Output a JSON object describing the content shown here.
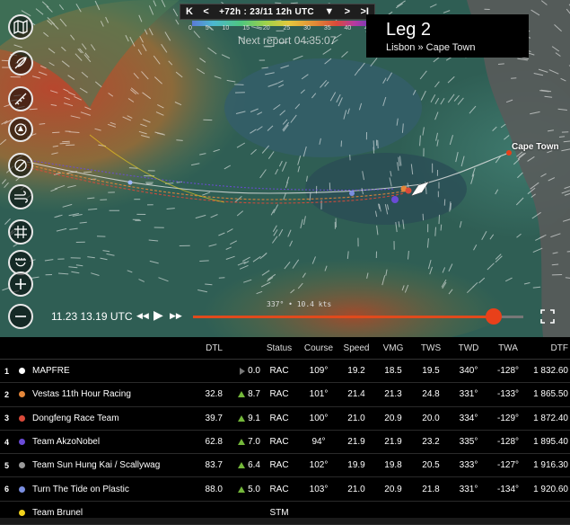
{
  "header": {
    "nav_first": "K",
    "nav_prev": "<",
    "time_label": "+72h : 23/11 12h UTC",
    "time_dropdown": "▼",
    "nav_next": ">",
    "nav_last": ">I",
    "legend_ticks": [
      "0",
      "5",
      "10",
      "15",
      "20",
      "25",
      "30",
      "35",
      "40",
      "45"
    ],
    "next_report": "Next report 04:35:07"
  },
  "leg": {
    "title": "Leg 2",
    "route": "Lisbon » Cape Town"
  },
  "map": {
    "destination_label": "Cape Town",
    "heading_readout": "337° • 10.4 kts",
    "tools": [
      "map-icon",
      "feather-icon",
      "ruler-icon",
      "boat-icon",
      "compass-icon",
      "wind-icon",
      "grid-icon",
      "sail-icon",
      "zoom-in-icon",
      "zoom-out-icon"
    ]
  },
  "playback": {
    "time": "11.23 13.19 UTC",
    "rewind": "◀◀",
    "play": "▶",
    "forward": "▶▶",
    "progress": 0.91
  },
  "table": {
    "headers": {
      "dtl": "DTL",
      "status": "Status",
      "course": "Course",
      "speed": "Speed",
      "vmg": "VMG",
      "tws": "TWS",
      "twd": "TWD",
      "twa": "TWA",
      "dtf": "DTF"
    },
    "rows": [
      {
        "rank": "1",
        "color": "#ffffff",
        "name": "MAPFRE",
        "dtl": "",
        "delta": "0.0",
        "delta_dir": "flat",
        "status": "RAC",
        "course": "109°",
        "speed": "19.2",
        "vmg": "18.5",
        "tws": "19.5",
        "twd": "340°",
        "twa": "-128°",
        "dtf": "1 832.60"
      },
      {
        "rank": "2",
        "color": "#e5873a",
        "name": "Vestas 11th Hour Racing",
        "dtl": "32.8",
        "delta": "8.7",
        "delta_dir": "up",
        "status": "RAC",
        "course": "101°",
        "speed": "21.4",
        "vmg": "21.3",
        "tws": "24.8",
        "twd": "331°",
        "twa": "-133°",
        "dtf": "1 865.50"
      },
      {
        "rank": "3",
        "color": "#d94a3a",
        "name": "Dongfeng Race Team",
        "dtl": "39.7",
        "delta": "9.1",
        "delta_dir": "up",
        "status": "RAC",
        "course": "100°",
        "speed": "21.0",
        "vmg": "20.9",
        "tws": "20.0",
        "twd": "334°",
        "twa": "-129°",
        "dtf": "1 872.40"
      },
      {
        "rank": "4",
        "color": "#6a4bd6",
        "name": "Team AkzoNobel",
        "dtl": "62.8",
        "delta": "7.0",
        "delta_dir": "up",
        "status": "RAC",
        "course": "94°",
        "speed": "21.9",
        "vmg": "21.9",
        "tws": "23.2",
        "twd": "335°",
        "twa": "-128°",
        "dtf": "1 895.40"
      },
      {
        "rank": "5",
        "color": "#9a9a9a",
        "name": "Team Sun Hung Kai / Scallywag",
        "dtl": "83.7",
        "delta": "6.4",
        "delta_dir": "up",
        "status": "RAC",
        "course": "102°",
        "speed": "19.9",
        "vmg": "19.8",
        "tws": "20.5",
        "twd": "333°",
        "twa": "-127°",
        "dtf": "1 916.30"
      },
      {
        "rank": "6",
        "color": "#7a8ee0",
        "name": "Turn The Tide on Plastic",
        "dtl": "88.0",
        "delta": "5.0",
        "delta_dir": "up",
        "status": "RAC",
        "course": "103°",
        "speed": "21.0",
        "vmg": "20.9",
        "tws": "21.8",
        "twd": "331°",
        "twa": "-134°",
        "dtf": "1 920.60"
      },
      {
        "rank": "",
        "color": "#f2d21c",
        "name": "Team Brunel",
        "dtl": "",
        "delta": "",
        "delta_dir": "none",
        "status": "STM",
        "course": "",
        "speed": "",
        "vmg": "",
        "tws": "",
        "twd": "",
        "twa": "",
        "dtf": ""
      }
    ]
  }
}
